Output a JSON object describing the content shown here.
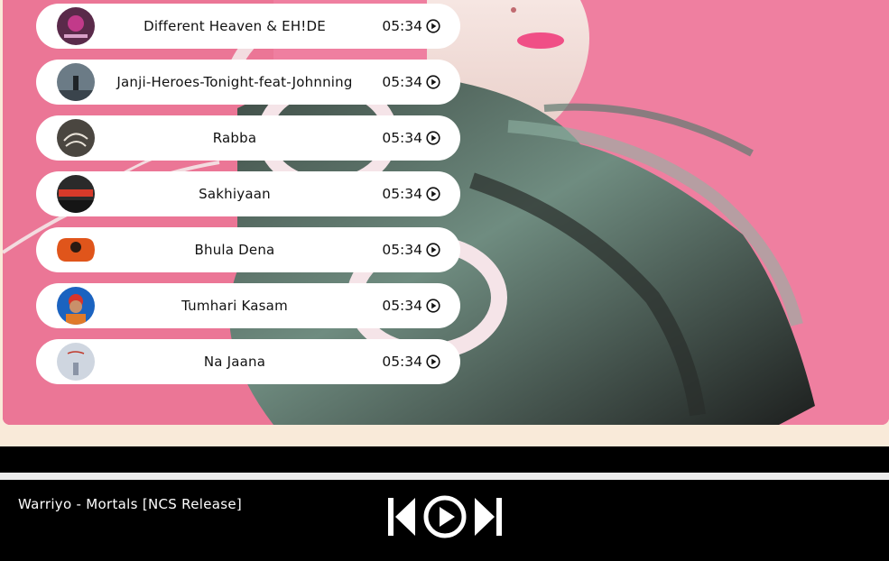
{
  "songs": [
    {
      "title": "Different Heaven & EH!DE",
      "duration": "05:34",
      "cover_color": "#5a2a4a"
    },
    {
      "title": "Janji-Heroes-Tonight-feat-Johnning",
      "duration": "05:34",
      "cover_color": "#6b7b86"
    },
    {
      "title": "Rabba",
      "duration": "05:34",
      "cover_color": "#4a4640"
    },
    {
      "title": "Sakhiyaan",
      "duration": "05:34",
      "cover_color": "#2a2a2a"
    },
    {
      "title": "Bhula Dena",
      "duration": "05:34",
      "cover_color": "#e0551b"
    },
    {
      "title": "Tumhari Kasam",
      "duration": "05:34",
      "cover_color": "#1b63c0"
    },
    {
      "title": "Na Jaana",
      "duration": "05:34",
      "cover_color": "#cfd6e0"
    }
  ],
  "player": {
    "now_playing": "Warriyo - Mortals [NCS Release]",
    "controls": [
      "previous-icon",
      "play-icon",
      "next-icon"
    ]
  },
  "colors": {
    "hero_pink": "#ef7fa0",
    "page_bg": "#f9ead9",
    "player_bg": "#000000",
    "item_bg": "#ffffff"
  }
}
